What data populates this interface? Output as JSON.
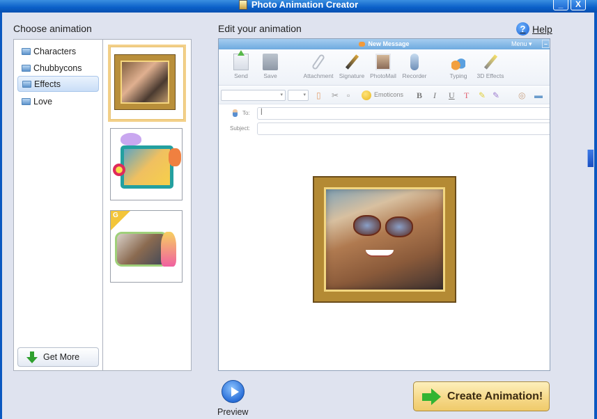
{
  "window": {
    "title": "Photo Animation Creator",
    "minimize_label": "_",
    "close_label": "X"
  },
  "left": {
    "title": "Choose animation",
    "categories": [
      {
        "label": "Characters",
        "selected": false
      },
      {
        "label": "Chubbycons",
        "selected": false
      },
      {
        "label": "Effects",
        "selected": true
      },
      {
        "label": "Love",
        "selected": false
      }
    ],
    "get_more_label": "Get More",
    "thumbnails": [
      {
        "name": "gold-frame-couple",
        "selected": true
      },
      {
        "name": "butterfly-kid-frame",
        "selected": false
      },
      {
        "name": "fairy-frame",
        "selected": false,
        "badge": "G"
      }
    ]
  },
  "editor": {
    "title": "Edit your animation",
    "help_label": "Help",
    "help_icon": "?",
    "message_window": {
      "title": "New Message",
      "menu_label": "Menu ▾",
      "minimize_label": "–",
      "toolbar": [
        {
          "label": "Send",
          "icon": "send-icon"
        },
        {
          "label": "Save",
          "icon": "save-icon"
        },
        {
          "label": "Attachment",
          "icon": "paperclip-icon"
        },
        {
          "label": "Signature",
          "icon": "pen-icon"
        },
        {
          "label": "PhotoMail",
          "icon": "photo-icon"
        },
        {
          "label": "Recorder",
          "icon": "microphone-icon"
        },
        {
          "label": "Typing",
          "icon": "music-note-icon"
        },
        {
          "label": "3D Effects",
          "icon": "magic-wand-icon"
        }
      ],
      "format_bar": {
        "emoticons_label": "Emoticons",
        "bold": "B",
        "italic": "I",
        "underline": "U",
        "text_color": "T"
      },
      "to_label": "To:",
      "to_value": "|",
      "subject_label": "Subject:",
      "subject_value": ""
    }
  },
  "footer": {
    "preview_label": "Preview",
    "create_label": "Create Animation!"
  }
}
